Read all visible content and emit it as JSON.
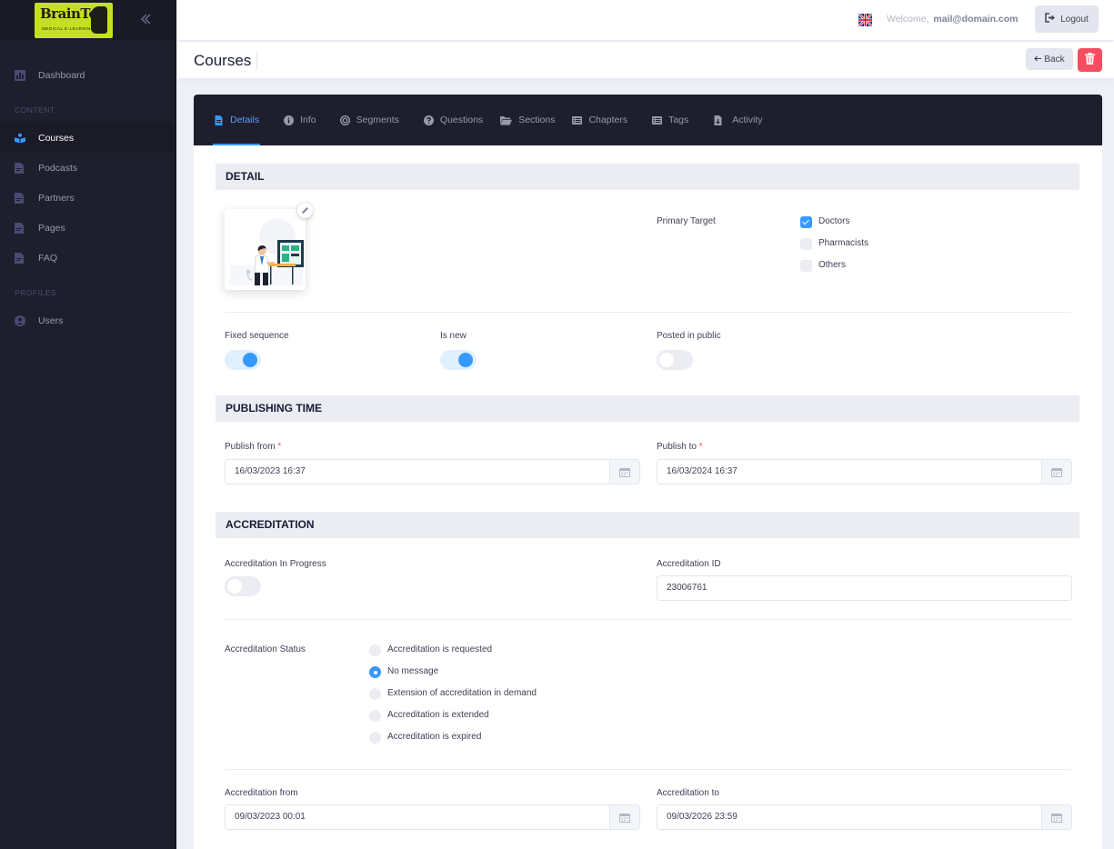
{
  "brand": {
    "logo_text": "BrainTop",
    "logo_subtext": "MEDICAL E-LEARNING",
    "accent_color": "#c5e01f"
  },
  "sidebar": {
    "items_top": [
      {
        "label": "Dashboard",
        "icon": "chart-bar-icon"
      }
    ],
    "sections": [
      {
        "title": "CONTENT",
        "items": [
          {
            "label": "Courses",
            "icon": "book-reader-icon",
            "active": true
          },
          {
            "label": "Podcasts",
            "icon": "file-icon"
          },
          {
            "label": "Partners",
            "icon": "file-icon"
          },
          {
            "label": "Pages",
            "icon": "file-icon"
          },
          {
            "label": "FAQ",
            "icon": "file-icon"
          }
        ]
      },
      {
        "title": "PROFILES",
        "items": [
          {
            "label": "Users",
            "icon": "user-circle-icon"
          }
        ]
      }
    ]
  },
  "topbar": {
    "welcome_label": "Welcome,",
    "user_email": "mail@domain.com",
    "logout_label": "Logout",
    "language_icon": "uk-flag-icon"
  },
  "page": {
    "title": "Courses",
    "back_label": "Back",
    "back_icon": "arrow-left-icon",
    "delete_icon": "trash-icon",
    "danger_color": "#f64e60",
    "primary_color": "#3699ff"
  },
  "tabs": [
    {
      "label": "Details",
      "icon": "file-text-icon",
      "active": true
    },
    {
      "label": "Info",
      "icon": "info-circle-icon"
    },
    {
      "label": "Segments",
      "icon": "target-icon"
    },
    {
      "label": "Questions",
      "icon": "question-circle-icon"
    },
    {
      "label": "Sections",
      "icon": "folder-open-icon"
    },
    {
      "label": "Chapters",
      "icon": "list-icon"
    },
    {
      "label": "Tags",
      "icon": "list-icon"
    },
    {
      "label": "Activity",
      "icon": "file-download-icon"
    }
  ],
  "detail": {
    "heading": "DETAIL",
    "primary_target_label": "Primary Target",
    "targets": [
      {
        "label": "Doctors",
        "checked": true
      },
      {
        "label": "Pharmacists",
        "checked": false
      },
      {
        "label": "Others",
        "checked": false
      }
    ],
    "toggles": [
      {
        "label": "Fixed sequence",
        "on": true
      },
      {
        "label": "Is new",
        "on": true
      },
      {
        "label": "Posted in public",
        "on": false
      }
    ]
  },
  "publishing": {
    "heading": "PUBLISHING TIME",
    "from_label": "Publish from",
    "from_value": "16/03/2023 16:37",
    "to_label": "Publish to",
    "to_value": "16/03/2024 16:37",
    "required_mark": "*"
  },
  "accreditation": {
    "heading": "ACCREDITATION",
    "in_progress_label": "Accreditation In Progress",
    "in_progress_on": false,
    "id_label": "Accreditation ID",
    "id_value": "23006761",
    "status_label": "Accreditation Status",
    "statuses": [
      {
        "label": "Accreditation is requested",
        "selected": false
      },
      {
        "label": "No message",
        "selected": true
      },
      {
        "label": "Extension of accreditation in demand",
        "selected": false
      },
      {
        "label": "Accreditation is extended",
        "selected": false
      },
      {
        "label": "Accreditation is expired",
        "selected": false
      }
    ],
    "from_label": "Accreditation from",
    "from_value": "09/03/2023 00:01",
    "to_label": "Accreditation to",
    "to_value": "09/03/2026 23:59"
  }
}
